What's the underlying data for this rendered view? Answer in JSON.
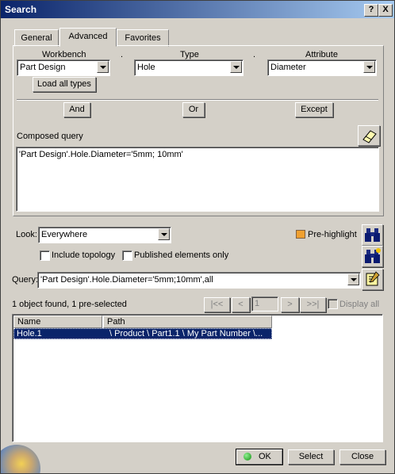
{
  "window": {
    "title": "Search",
    "help_btn": "?",
    "close_btn": "X"
  },
  "tabs": [
    {
      "label": "General",
      "active": false
    },
    {
      "label": "Advanced",
      "active": true
    },
    {
      "label": "Favorites",
      "active": false
    }
  ],
  "advanced": {
    "workbench_label": "Workbench",
    "type_label": "Type",
    "attribute_label": "Attribute",
    "dot": ".",
    "workbench_value": "Part Design",
    "type_value": "Hole",
    "attribute_value": "Diameter",
    "load_all_types": "Load all types",
    "and_btn": "And",
    "or_btn": "Or",
    "except_btn": "Except",
    "composed_query_label": "Composed query",
    "composed_query_text": "'Part Design'.Hole.Diameter='5mm; 10mm'"
  },
  "look": {
    "label": "Look:",
    "value": "Everywhere",
    "prehighlight_label": "Pre-highlight",
    "include_topology_label": "Include topology",
    "published_only_label": "Published elements only"
  },
  "query": {
    "label": "Query:",
    "value": "'Part Design'.Hole.Diameter='5mm;10mm',all"
  },
  "results": {
    "status": "1 object found, 1 pre-selected",
    "page_value": "1",
    "first_btn": "|<<",
    "prev_btn": "<",
    "next_btn": ">",
    "last_btn": ">>|",
    "display_all_label": "Display all",
    "columns": [
      "Name",
      "Path"
    ],
    "rows": [
      {
        "name": "Hole.1",
        "path": "\\ Product \\ Part1.1 \\ My Part Number \\..."
      }
    ]
  },
  "footer": {
    "ok": "OK",
    "select": "Select",
    "close": "Close"
  },
  "colors": {
    "title_start": "#0a246a",
    "title_end": "#a6caf0",
    "selection": "#0a246a",
    "face": "#d4d0c8"
  }
}
